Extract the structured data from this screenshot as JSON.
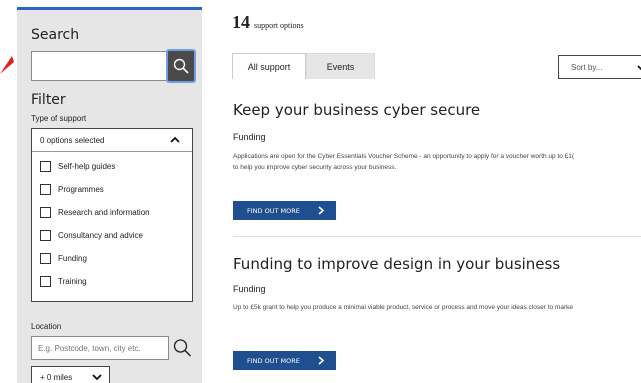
{
  "sidebar": {
    "search_title": "Search",
    "search_placeholder": "",
    "filter_title": "Filter",
    "type_label": "Type of support",
    "type_selected": "0 options selected",
    "options": [
      "Self-help guides",
      "Programmes",
      "Research and information",
      "Consultancy and advice",
      "Funding",
      "Training"
    ],
    "location_label": "Location",
    "location_placeholder": "E.g. Postcode, town, city etc.",
    "miles": "+ 0 miles"
  },
  "main": {
    "count": "14",
    "count_label": "support options",
    "tabs": [
      "All support",
      "Events"
    ],
    "sort_label": "Sort by...",
    "results": [
      {
        "title": "Keep your business cyber secure",
        "category": "Funding",
        "desc_line1": "Applications are open for the Cyber Essentials Voucher Scheme - an opportunity to apply for a voucher worth up to £1(",
        "desc_line2": "to help you improve cyber security across your business.",
        "button": "FIND OUT MORE"
      },
      {
        "title": "Funding to improve design in your business",
        "category": "Funding",
        "desc_line1": "Up to £5k grant to help you produce a minimal viable product, service or process and move your ideas closer to marke",
        "button": "FIND OUT MORE"
      }
    ]
  },
  "colors": {
    "accent": "#2a66c6",
    "button": "#1f4f8f",
    "arrow": "#e02020",
    "sidebar_bg": "#e6e6e6"
  }
}
